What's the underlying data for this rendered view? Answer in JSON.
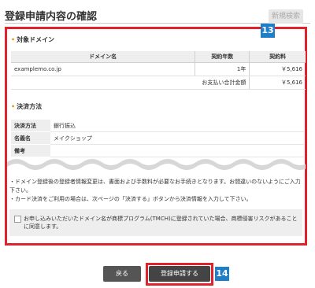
{
  "header": {
    "title": "登録申請内容の確認",
    "new_search_label": "新規検索"
  },
  "callouts": {
    "c13": "13",
    "c14": "14"
  },
  "domain_section": {
    "heading": "対象ドメイン",
    "columns": [
      "ドメイン名",
      "契約年数",
      "契約料"
    ],
    "rows": [
      {
        "domain": "examplemo.co.jp",
        "years": "1年",
        "fee": "￥5,616"
      }
    ],
    "total_label": "お支払い合計金額",
    "total_value": "￥5,616"
  },
  "payment_section": {
    "heading": "決済方法",
    "rows": [
      {
        "label": "決済方法",
        "value": "銀行振込"
      },
      {
        "label": "名義名",
        "value": "メイクショップ"
      },
      {
        "label": "備考",
        "value": ""
      }
    ]
  },
  "notes": [
    "・ドメイン登録後の登録者情報変更は、書面および手数料が必要なお手続きとなります。お間違いのないようにご入力下さい。",
    "・カード決済をご利用の場合は、次ページの「決済する」ボタンから決済情報を入力して下さい。"
  ],
  "consent": {
    "text": "お申し込みいただいたドメイン名が商標プログラム(TMCH)に登録されていた場合、商標侵害リスクがあることに同意します。",
    "checked": false
  },
  "buttons": {
    "back_label": "戻る",
    "register_label": "登録申請する"
  },
  "colors": {
    "highlight_frame": "#e0222c",
    "callout_badge": "#1e7ec8",
    "section_bullet": "#e59a1b"
  }
}
